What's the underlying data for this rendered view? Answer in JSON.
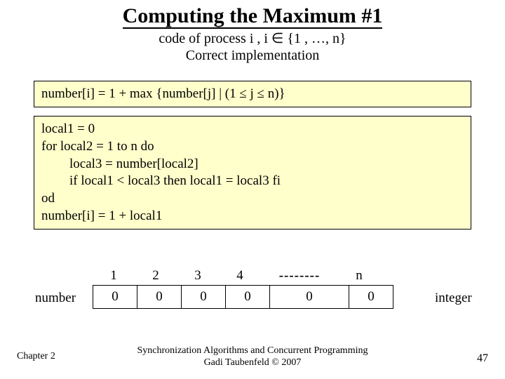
{
  "title": "Computing the Maximum #1",
  "subtitle_line1": "code of process i ,   i ∈ {1 , …, n}",
  "subtitle_line2": "Correct implementation",
  "box1": "number[i] = 1 + max {number[j] | (1 ≤ j ≤ n)}",
  "box2": {
    "l1": "local1 = 0",
    "l2": "for local2 = 1 to n do",
    "l3": "local3 = number[local2]",
    "l4": "if local1 < local3 then local1 = local3 fi",
    "l5": "od",
    "l6": "number[i] = 1 + local1"
  },
  "array": {
    "label_left": "number",
    "label_right": "integer",
    "idx": [
      "1",
      "2",
      "3",
      "4",
      "--------",
      "n"
    ],
    "cells": [
      "0",
      "0",
      "0",
      "0",
      "0",
      "0"
    ]
  },
  "footer": {
    "left": "Chapter 2",
    "center_l1": "Synchronization Algorithms and Concurrent Programming",
    "center_l2": "Gadi Taubenfeld © 2007",
    "right": "47"
  }
}
